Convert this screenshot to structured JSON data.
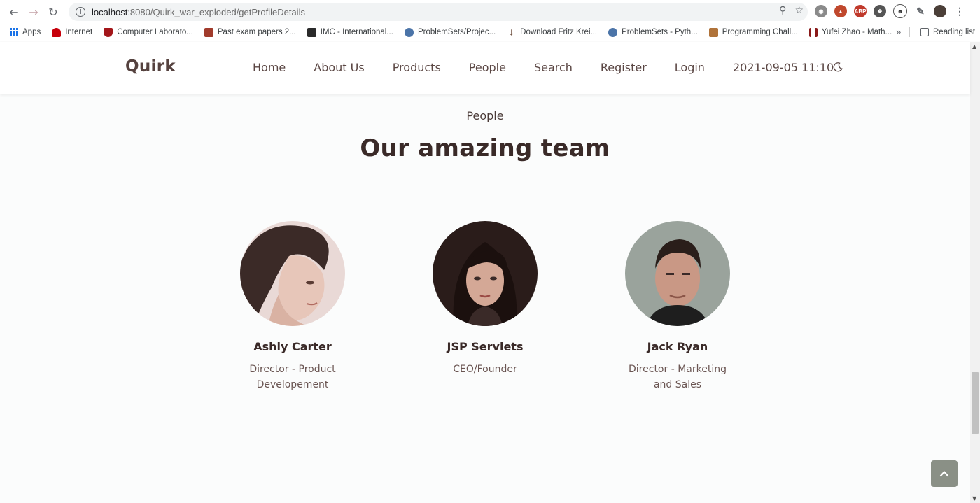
{
  "browser": {
    "url_host": "localhost",
    "url_rest": ":8080/Quirk_war_exploded/getProfileDetails",
    "bookmarks": [
      {
        "label": "Apps",
        "icon": "apps-grid-icon"
      },
      {
        "label": "Internet",
        "icon": "huawei-icon",
        "color": "#c7000b"
      },
      {
        "label": "Computer Laborato...",
        "icon": "cambridge-shield-icon",
        "color": "#a3161a"
      },
      {
        "label": "Past exam papers 2...",
        "icon": "cambridge-icon",
        "color": "#a13b2c"
      },
      {
        "label": "IMC - International...",
        "icon": "imc-icon",
        "color": "#2a2a2a"
      },
      {
        "label": "ProblemSets/Projec...",
        "icon": "python-icon",
        "color": "#4b74a8"
      },
      {
        "label": "Download Fritz Krei...",
        "icon": "download-icon",
        "color": "#6b4b3a"
      },
      {
        "label": "ProblemSets - Pyth...",
        "icon": "python-icon",
        "color": "#4b74a8"
      },
      {
        "label": "Programming Chall...",
        "icon": "java-icon",
        "color": "#b0733a"
      },
      {
        "label": "Yufei Zhao - Math...",
        "icon": "mit-icon",
        "color": "#8a1a1a"
      }
    ],
    "more": "»",
    "reading_list": "Reading list"
  },
  "header": {
    "brand": "Quirk",
    "nav": [
      "Home",
      "About Us",
      "Products",
      "People",
      "Search",
      "Register",
      "Login"
    ],
    "clock": "2021-09-05 11:10"
  },
  "section": {
    "kicker": "People",
    "title": "Our amazing team"
  },
  "team": [
    {
      "name": "Ashly Carter",
      "role": "Director - Product Developement"
    },
    {
      "name": "JSP Servlets",
      "role": "CEO/Founder"
    },
    {
      "name": "Jack Ryan",
      "role": "Director - Marketing and Sales"
    }
  ],
  "colors": {
    "accent": "#3a2a28",
    "text_muted": "#6a5552",
    "to_top": "#8a9086"
  }
}
